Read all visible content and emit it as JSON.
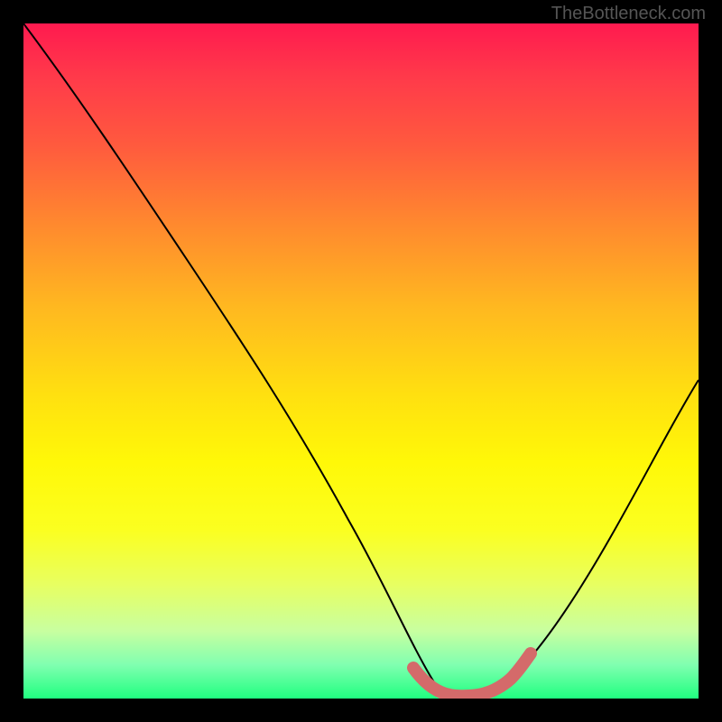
{
  "watermark": "TheBottleneck.com",
  "chart_data": {
    "type": "line",
    "title": "",
    "xlabel": "",
    "ylabel": "",
    "xlim": [
      0,
      100
    ],
    "ylim": [
      0,
      100
    ],
    "series": [
      {
        "name": "curve",
        "x": [
          0,
          5,
          10,
          15,
          20,
          25,
          30,
          35,
          40,
          45,
          50,
          55,
          58,
          60,
          62,
          65,
          68,
          70,
          75,
          80,
          85,
          90,
          95,
          100
        ],
        "values": [
          100,
          92,
          85,
          78,
          70,
          62,
          54,
          46,
          37,
          27,
          17,
          8,
          4,
          2,
          1,
          1,
          2,
          4,
          10,
          19,
          30,
          41,
          50,
          55
        ]
      }
    ],
    "highlight_range": {
      "x_start": 55,
      "x_end": 72,
      "description": "optimal zone near curve minimum"
    },
    "background_gradient": {
      "top": "#ff1a4f",
      "middle": "#ffe010",
      "bottom": "#20ff80"
    }
  }
}
